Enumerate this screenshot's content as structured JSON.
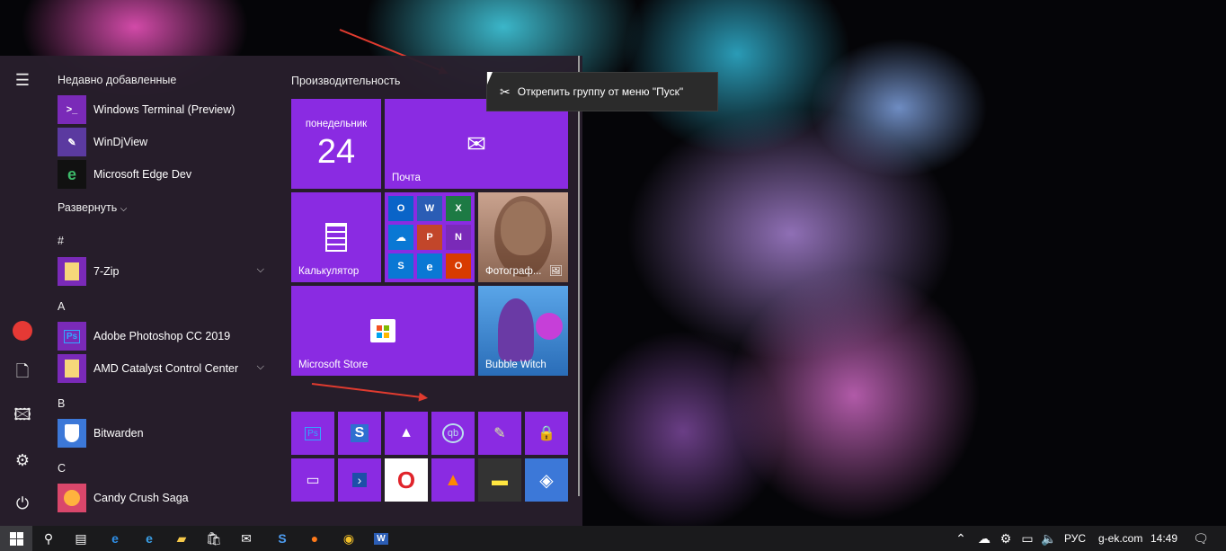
{
  "start_menu": {
    "recent_header": "Недавно добавленные",
    "recent": [
      {
        "label": "Windows Terminal (Preview)",
        "icon": "terminal-icon",
        "color": "#7a2ab8"
      },
      {
        "label": "WinDjView",
        "icon": "windjview-icon",
        "color": "#5b3aa0"
      },
      {
        "label": "Microsoft Edge Dev",
        "icon": "edge-dev-icon",
        "color": "#1a1a1a"
      }
    ],
    "expand_label": "Развернуть",
    "letters": {
      "hash": "#",
      "a": "A",
      "b": "B",
      "c": "C"
    },
    "apps": [
      {
        "label": "7-Zip",
        "icon": "folder-icon"
      },
      {
        "label": "Adobe Photoshop CC 2019",
        "icon": "photoshop-icon",
        "glyph": "Ps"
      },
      {
        "label": "AMD Catalyst Control Center",
        "icon": "folder-icon"
      },
      {
        "label": "Bitwarden",
        "icon": "bitwarden-icon"
      },
      {
        "label": "Candy Crush Saga",
        "icon": "candy-crush-icon"
      }
    ],
    "group_title": "Производительность",
    "tiles": {
      "calendar_day": "понедельник",
      "calendar_date": "24",
      "mail": "Почта",
      "calculator": "Калькулятор",
      "photos": "Фотограф...",
      "store": "Microsoft Store",
      "game": "Bubble Witch"
    },
    "office_glyphs": [
      "O",
      "W",
      "X",
      "☁",
      "P",
      "N",
      "S",
      "e",
      "O"
    ],
    "mini_glyphs": [
      "Ps",
      "S",
      "▲",
      "qb",
      "✎",
      "🔒",
      "▭",
      "›",
      "O",
      "▲",
      "▬",
      "◈"
    ]
  },
  "tooltip": {
    "label": "Открепить группу от меню \"Пуск\""
  },
  "taskbar": {
    "language": "РУС",
    "site": "g-ek.com",
    "time": "14:49"
  },
  "colors": {
    "tile": "#8a2be2",
    "accent_red": "#e03b2f"
  }
}
